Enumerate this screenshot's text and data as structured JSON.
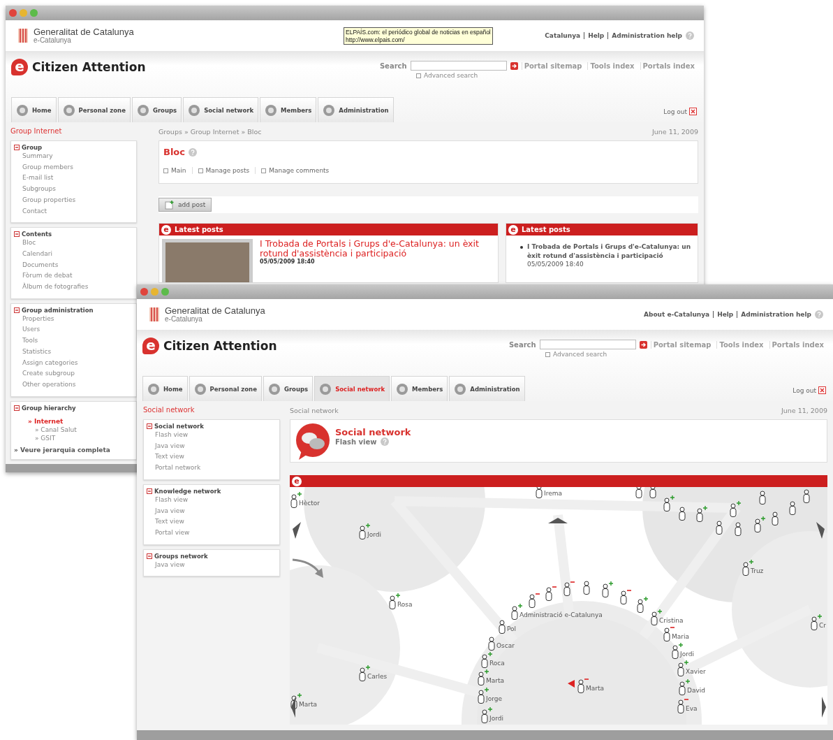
{
  "back_window": {
    "logo_letter": "e",
    "org": "Generalitat de Catalunya",
    "org_sub": "e-Catalunya",
    "top_links": [
      "Catalunya",
      "Help",
      "Administration help"
    ],
    "tooltip": {
      "lines": [
        "ELPAÍS.com: el periódico global de noticias en español",
        "http://www.elpais.com/"
      ]
    },
    "app_title": "Citizen Attention",
    "search": {
      "label": "Search",
      "advanced": "Advanced search"
    },
    "portal_links": [
      "Portal sitemap",
      "Tools index",
      "Portals index"
    ],
    "tabs": [
      {
        "label": "Home",
        "selected": false
      },
      {
        "label": "Personal zone",
        "selected": false
      },
      {
        "label": "Groups",
        "selected": false
      },
      {
        "label": "Social network",
        "selected": false
      },
      {
        "label": "Members",
        "selected": false
      },
      {
        "label": "Administration",
        "selected": false
      }
    ],
    "logout": "Log out",
    "sidebar_title": "Group Internet",
    "sections": [
      {
        "title": "Group",
        "items": [
          "Summary",
          "Group members",
          "E-mail list",
          "Subgroups",
          "Group properties",
          "Contact"
        ]
      },
      {
        "title": "Contents",
        "items": [
          "Bloc",
          "Calendari",
          "Documents",
          "Fòrum de debat",
          "Àlbum de fotografies"
        ]
      },
      {
        "title": "Group administration",
        "items": [
          "Properties",
          "Users",
          "Tools",
          "Statistics",
          "Assign categories",
          "Create subgroup",
          "Other operations"
        ]
      }
    ],
    "hierarchy": {
      "title": "Group hierarchy",
      "items": [
        {
          "label": "» Internet",
          "selected": true
        },
        {
          "label": "» Canal Salut",
          "selected": false
        },
        {
          "label": "» GSIT",
          "selected": false
        }
      ],
      "more": "» Veure jerarquia completa"
    },
    "breadcrumb": "Groups » Group Internet » Bloc",
    "date": "June 11, 2009",
    "page_title": "Bloc",
    "subtabs": [
      "Main",
      "Manage posts",
      "Manage comments"
    ],
    "add_button": "add post",
    "posts_panel": {
      "badge": "e",
      "title": "Latest posts",
      "post_title": "I Trobada de Portals i Grups d'e-Catalunya: un èxit rotund d'assistència i participació",
      "post_date": "05/05/2009 18:40"
    },
    "list_panel": {
      "badge": "e",
      "title": "Latest posts",
      "items": [
        {
          "text": "I Trobada de Portals i Grups d'e-Catalunya: un èxit rotund d'assistència i participació",
          "date": "05/05/2009 18:40"
        }
      ]
    }
  },
  "front_window": {
    "logo_letter": "e",
    "org": "Generalitat de Catalunya",
    "org_sub": "e-Catalunya",
    "top_links": [
      "About e-Catalunya",
      "Help",
      "Administration help"
    ],
    "app_title": "Citizen Attention",
    "search": {
      "label": "Search",
      "advanced": "Advanced search"
    },
    "portal_links": [
      "Portal sitemap",
      "Tools index",
      "Portals index"
    ],
    "tabs": [
      {
        "label": "Home",
        "selected": false
      },
      {
        "label": "Personal zone",
        "selected": false
      },
      {
        "label": "Groups",
        "selected": false
      },
      {
        "label": "Social network",
        "selected": true
      },
      {
        "label": "Members",
        "selected": false
      },
      {
        "label": "Administration",
        "selected": false
      }
    ],
    "logout": "Log out",
    "sidebar_title": "Social network",
    "sections": [
      {
        "title": "Social network",
        "items": [
          "Flash view",
          "Java view",
          "Text view",
          "Portal network"
        ]
      },
      {
        "title": "Knowledge network",
        "items": [
          "Flash view",
          "Java view",
          "Text view",
          "Portal view"
        ]
      },
      {
        "title": "Groups network",
        "items": [
          "Java view"
        ]
      }
    ],
    "breadcrumb": "Social network",
    "date": "June 11, 2009",
    "page_title": "Social network",
    "page_subtitle": "Flash view",
    "network_panel": {
      "badge": "e",
      "nodes": [
        {
          "label": "Hèctor",
          "kind": "plus"
        },
        {
          "label": "Irema",
          "kind": "plain"
        },
        {
          "label": "Jordi",
          "kind": "plus"
        },
        {
          "label": "Rosa",
          "kind": "plus"
        },
        {
          "label": "Carles",
          "kind": "plus"
        },
        {
          "label": "Marta",
          "kind": "plus"
        },
        {
          "label": "Truz",
          "kind": "plus"
        },
        {
          "label": "Cr",
          "kind": "plus"
        },
        {
          "label": "Marta",
          "kind": "minus"
        },
        {
          "label": "Administració e-Catalunya",
          "kind": "plus"
        },
        {
          "label": "Pol",
          "kind": "plain"
        },
        {
          "label": "Oscar",
          "kind": "plain"
        },
        {
          "label": "Roca",
          "kind": "plus"
        },
        {
          "label": "Marta",
          "kind": "plus"
        },
        {
          "label": "Jorge",
          "kind": "plus"
        },
        {
          "label": "Jordi",
          "kind": "plus"
        },
        {
          "label": "Cristina",
          "kind": "plus"
        },
        {
          "label": "Maria",
          "kind": "minus"
        },
        {
          "label": "Jordi",
          "kind": "plus"
        },
        {
          "label": "Xavier",
          "kind": "plus"
        },
        {
          "label": "David",
          "kind": "plus"
        },
        {
          "label": "Eva",
          "kind": "minus"
        },
        {
          "kind": "minus"
        },
        {
          "kind": "minus"
        },
        {
          "kind": "minus"
        },
        {
          "kind": "plain"
        },
        {
          "kind": "plus"
        },
        {
          "kind": "minus"
        },
        {
          "kind": "plus"
        },
        {
          "kind": "plain"
        },
        {
          "kind": "plain"
        },
        {
          "kind": "plus"
        },
        {
          "kind": "plain"
        },
        {
          "kind": "plus"
        },
        {
          "kind": "plain"
        },
        {
          "kind": "plus"
        },
        {
          "kind": "plain"
        },
        {
          "kind": "plus"
        },
        {
          "kind": "plain"
        },
        {
          "kind": "plain"
        },
        {
          "kind": "plain"
        },
        {
          "kind": "plain"
        }
      ]
    }
  }
}
